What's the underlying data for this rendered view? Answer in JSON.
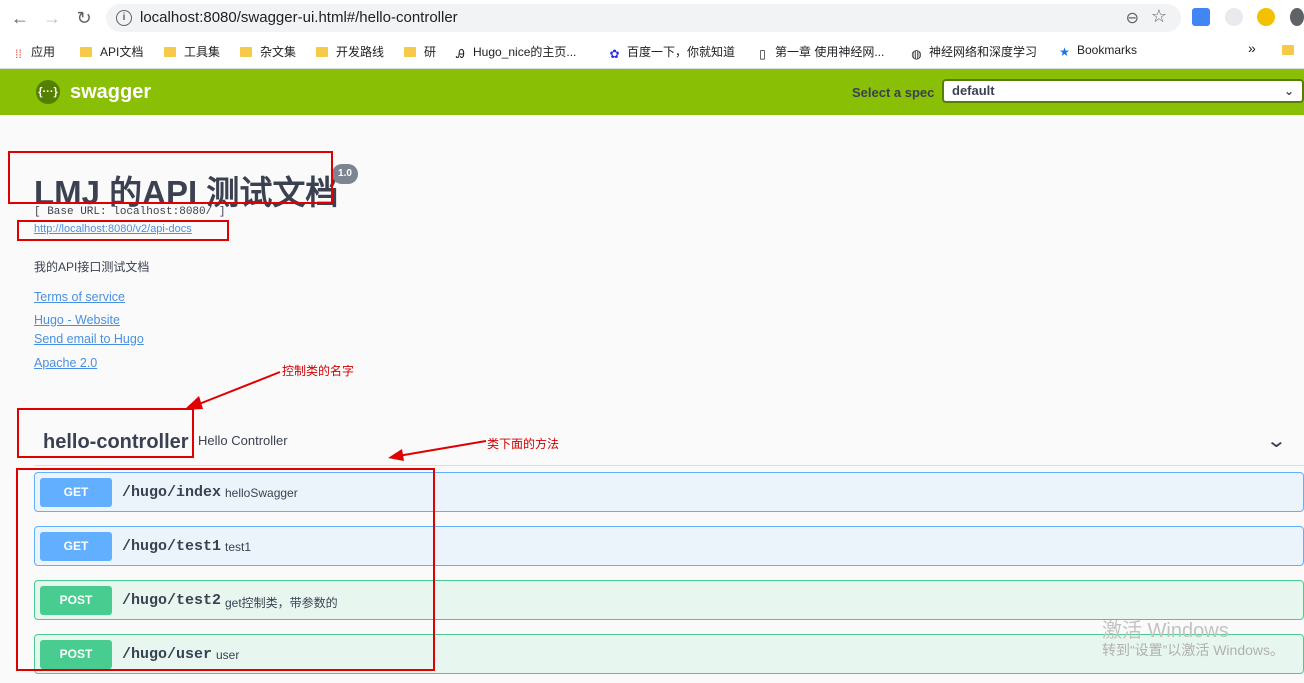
{
  "browser": {
    "url": "localhost:8080/swagger-ui.html#/hello-controller",
    "bookmarks": [
      {
        "label": "应用",
        "kind": "apps"
      },
      {
        "label": "API文档",
        "kind": "folder"
      },
      {
        "label": "工具集",
        "kind": "folder"
      },
      {
        "label": "杂文集",
        "kind": "folder"
      },
      {
        "label": "开发路线",
        "kind": "folder"
      },
      {
        "label": "研",
        "kind": "folder"
      },
      {
        "label": "Hugo_nice的主页...",
        "kind": "page"
      },
      {
        "label": "百度一下，你就知道",
        "kind": "page"
      },
      {
        "label": "第一章 使用神经网...",
        "kind": "page"
      },
      {
        "label": "神经网络和深度学习",
        "kind": "page"
      },
      {
        "label": "Bookmarks",
        "kind": "star"
      }
    ],
    "more": "»"
  },
  "topbar": {
    "logo_text": "swagger",
    "logo_mark": "{···}",
    "spec_label": "Select a spec",
    "spec_value": "default"
  },
  "info": {
    "title": "LMJ 的API 测试文档",
    "version": "1.0",
    "base_url": "[ Base URL: localhost:8080/ ]",
    "api_docs_link": "http://localhost:8080/v2/api-docs",
    "description": "我的API接口测试文档",
    "terms": "Terms of service",
    "website": "Hugo - Website",
    "email": "Send email to Hugo",
    "license": "Apache 2.0"
  },
  "tag": {
    "name": "hello-controller",
    "description": "Hello Controller"
  },
  "operations": [
    {
      "method": "GET",
      "path": "/hugo/index",
      "summary": "helloSwagger"
    },
    {
      "method": "GET",
      "path": "/hugo/test1",
      "summary": "test1"
    },
    {
      "method": "POST",
      "path": "/hugo/test2",
      "summary": "get控制类，带参数的"
    },
    {
      "method": "POST",
      "path": "/hugo/user",
      "summary": "user"
    }
  ],
  "annotations": {
    "controller_note": "控制类的名字",
    "methods_note": "类下面的方法"
  },
  "watermark": {
    "line1": "激活 Windows",
    "line2": "转到“设置”以激活 Windows。"
  },
  "colors": {
    "topbar": "#89bf04",
    "get": "#61affe",
    "post": "#49cc90",
    "annotation": "#e00000"
  }
}
